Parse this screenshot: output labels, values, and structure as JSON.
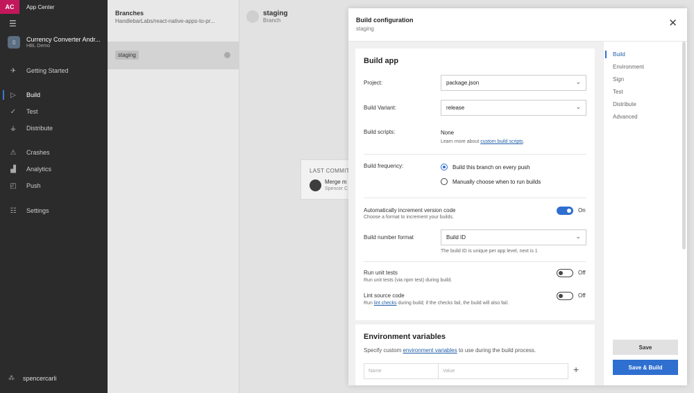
{
  "nav": {
    "logo_text": "AC",
    "app_center_label": "App Center",
    "menu_icon": "hamburger-icon",
    "app": {
      "name": "Currency Converter Andr...",
      "org": "HBL Demo",
      "icon": "app-icon"
    },
    "items": [
      {
        "label": "Getting Started",
        "icon": "rocket-icon",
        "active": false
      },
      {
        "label": "Build",
        "icon": "play-icon",
        "active": true
      },
      {
        "label": "Test",
        "icon": "check-circle-icon",
        "active": false
      },
      {
        "label": "Distribute",
        "icon": "distribute-icon",
        "active": false
      },
      {
        "label": "Crashes",
        "icon": "warning-icon",
        "active": false
      },
      {
        "label": "Analytics",
        "icon": "analytics-icon",
        "active": false
      },
      {
        "label": "Push",
        "icon": "push-icon",
        "active": false
      },
      {
        "label": "Settings",
        "icon": "sliders-icon",
        "active": false
      }
    ],
    "user": "spencercarli"
  },
  "branches": {
    "title": "Branches",
    "repo": "HandlebarLabs/react-native-apps-to-pr...",
    "selected_branch": "staging"
  },
  "main": {
    "title": "staging",
    "subtitle": "Branch",
    "commit": {
      "label": "LAST COMMIT",
      "message": "Merge m",
      "author": "Spencer C"
    }
  },
  "modal": {
    "title": "Build configuration",
    "subtitle": "staging",
    "build_app": {
      "title": "Build app",
      "project_label": "Project:",
      "project_value": "package.json",
      "variant_label": "Build Variant:",
      "variant_value": "release",
      "scripts_label": "Build scripts:",
      "scripts_value": "None",
      "scripts_help_prefix": "Learn more about ",
      "scripts_help_link": "custom build scripts",
      "scripts_help_suffix": ".",
      "frequency_label": "Build frequency:",
      "freq_option1": "Build this branch on every push",
      "freq_option2": "Manually choose when to run builds",
      "auto_inc_label": "Automatically increment version code",
      "auto_inc_help": "Choose a format to increment your builds.",
      "auto_inc_state": "On",
      "number_format_label": "Build number format",
      "number_format_value": "Build ID",
      "number_format_help": "The build ID is unique per app level, next is 1",
      "unit_tests_label": "Run unit tests",
      "unit_tests_help": "Run unit tests (via npm test) during build.",
      "unit_tests_state": "Off",
      "lint_label": "Lint source code",
      "lint_help_prefix": "Run ",
      "lint_help_link": "lint checks",
      "lint_help_suffix": " during build; if the checks fail, the build will also fail.",
      "lint_state": "Off"
    },
    "env": {
      "title": "Environment variables",
      "help_prefix": "Specify custom ",
      "help_link": "environment variables",
      "help_suffix": " to use during the build process.",
      "name_placeholder": "Name",
      "value_placeholder": "Value"
    },
    "side_nav": [
      "Build",
      "Environment",
      "Sign",
      "Test",
      "Distribute",
      "Advanced"
    ],
    "save_label": "Save",
    "save_build_label": "Save & Build"
  }
}
